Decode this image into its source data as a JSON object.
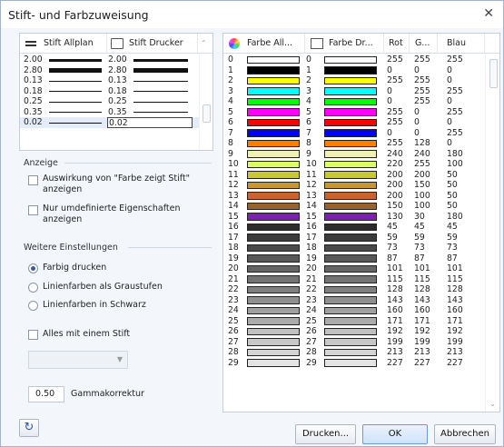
{
  "title": "Stift- und Farbzuweisung",
  "pen_table": {
    "headers": [
      "Stift Allplan",
      "Stift Drucker"
    ],
    "rows": [
      [
        "2.00",
        "2.00"
      ],
      [
        "2.80",
        "2.80"
      ],
      [
        "0.13",
        "0.13"
      ],
      [
        "0.18",
        "0.18"
      ],
      [
        "0.25",
        "0.25"
      ],
      [
        "0.35",
        "0.35"
      ],
      [
        "0.02",
        "0.02"
      ]
    ]
  },
  "anzeige": {
    "title": "Anzeige",
    "cb1": "Auswirkung von \"Farbe zeigt Stift\" anzeigen",
    "cb2": "Nur umdefinierte Eigenschaften anzeigen"
  },
  "weitere": {
    "title": "Weitere Einstellungen",
    "r1": "Farbig drucken",
    "r2": "Linienfarben als Graustufen",
    "r3": "Linienfarben in Schwarz",
    "cb_alles": "Alles mit einem Stift"
  },
  "gamma": {
    "value": "0.50",
    "label": "Gammakorrektur"
  },
  "color_table": {
    "headers": [
      "Farbe All...",
      "Farbe Dr...",
      "Rot",
      "G...",
      "Blau"
    ],
    "rows": [
      [
        "0",
        "0",
        "255",
        "255",
        "255"
      ],
      [
        "1",
        "1",
        "0",
        "0",
        "0"
      ],
      [
        "2",
        "2",
        "255",
        "255",
        "0"
      ],
      [
        "3",
        "3",
        "0",
        "255",
        "255"
      ],
      [
        "4",
        "4",
        "0",
        "255",
        "0"
      ],
      [
        "5",
        "5",
        "255",
        "0",
        "255"
      ],
      [
        "6",
        "6",
        "255",
        "0",
        "0"
      ],
      [
        "7",
        "7",
        "0",
        "0",
        "255"
      ],
      [
        "8",
        "8",
        "255",
        "128",
        "0"
      ],
      [
        "9",
        "9",
        "240",
        "240",
        "180"
      ],
      [
        "10",
        "10",
        "220",
        "255",
        "100"
      ],
      [
        "11",
        "11",
        "200",
        "200",
        "50"
      ],
      [
        "12",
        "12",
        "200",
        "150",
        "50"
      ],
      [
        "13",
        "13",
        "200",
        "100",
        "50"
      ],
      [
        "14",
        "14",
        "150",
        "100",
        "50"
      ],
      [
        "15",
        "15",
        "130",
        "30",
        "180"
      ],
      [
        "16",
        "16",
        "45",
        "45",
        "45"
      ],
      [
        "17",
        "17",
        "59",
        "59",
        "59"
      ],
      [
        "18",
        "18",
        "73",
        "73",
        "73"
      ],
      [
        "19",
        "19",
        "87",
        "87",
        "87"
      ],
      [
        "20",
        "20",
        "101",
        "101",
        "101"
      ],
      [
        "21",
        "21",
        "115",
        "115",
        "115"
      ],
      [
        "22",
        "22",
        "128",
        "128",
        "128"
      ],
      [
        "23",
        "23",
        "143",
        "143",
        "143"
      ],
      [
        "24",
        "24",
        "160",
        "160",
        "160"
      ],
      [
        "25",
        "25",
        "171",
        "171",
        "171"
      ],
      [
        "26",
        "26",
        "192",
        "192",
        "192"
      ],
      [
        "27",
        "27",
        "199",
        "199",
        "199"
      ],
      [
        "28",
        "28",
        "213",
        "213",
        "213"
      ],
      [
        "29",
        "29",
        "227",
        "227",
        "227"
      ]
    ]
  },
  "buttons": {
    "print": "Drucken...",
    "ok": "OK",
    "cancel": "Abbrechen"
  }
}
